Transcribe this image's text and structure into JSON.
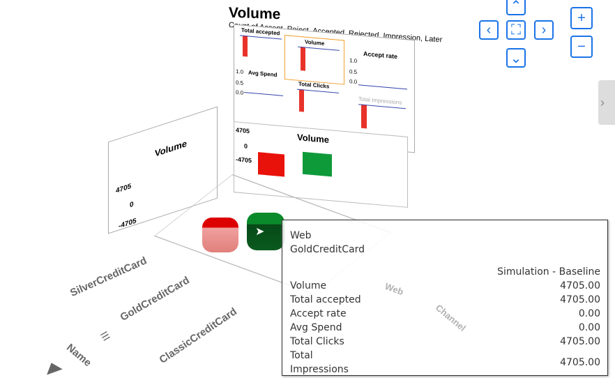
{
  "main_chart": {
    "title": "Volume",
    "subtitle": "Count of Accept, Reject, Accepted, Rejected, Impression, Later",
    "minis": [
      {
        "title": "Total accepted"
      },
      {
        "title": "Volume"
      },
      {
        "title": "Accept rate",
        "ticks": [
          "1.0",
          "0.5",
          "0.0"
        ]
      },
      {
        "title": "Avg Spend",
        "ticks": [
          "1.0",
          "0.5",
          "0.0"
        ]
      },
      {
        "title": "Total Clicks"
      },
      {
        "title": "Total Impressions"
      }
    ],
    "volume_panel": {
      "title": "Volume",
      "ticks": [
        "4705",
        "0",
        "-4705"
      ]
    }
  },
  "side_chart": {
    "title": "Volume",
    "ticks": [
      "4705",
      "0",
      "-4705"
    ]
  },
  "axis": {
    "name_label": "Name",
    "channel_label": "Channel",
    "web_label": "Web",
    "names": [
      "SilverCreditCard",
      "GoldCreditCard",
      "ClassicCreditCard"
    ]
  },
  "colors": {
    "red": "#e8332a",
    "green": "#0f9a3a",
    "accent": "#1a73e8"
  },
  "nav": {
    "up": "⌃",
    "down": "⌄",
    "left": "‹",
    "right": "›",
    "fit": "⛶",
    "zoom_in": "+",
    "zoom_out": "−"
  },
  "tooltip": {
    "line1": "Web",
    "line2": "GoldCreditCard",
    "column": "Simulation - Baseline",
    "rows": [
      {
        "label": "Volume",
        "value": "4705.00"
      },
      {
        "label": "Total accepted",
        "value": "4705.00"
      },
      {
        "label": "Accept rate",
        "value": "0.00"
      },
      {
        "label": "Avg Spend",
        "value": "0.00"
      },
      {
        "label": "Total Clicks",
        "value": "4705.00"
      }
    ],
    "last_label_1": "Total",
    "last_label_2": "Impressions",
    "last_value": "4705.00"
  }
}
